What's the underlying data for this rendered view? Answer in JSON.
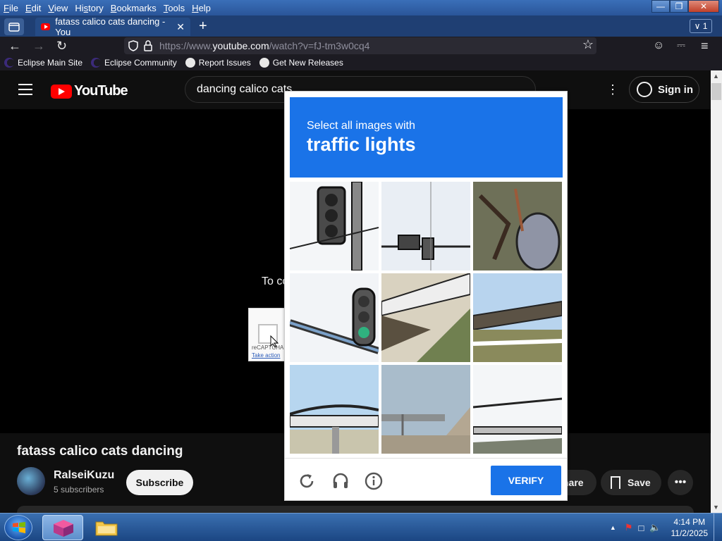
{
  "menubar": {
    "items": [
      "File",
      "Edit",
      "View",
      "History",
      "Bookmarks",
      "Tools",
      "Help"
    ],
    "underlines": [
      "F",
      "E",
      "V",
      "s",
      "B",
      "T",
      "H"
    ]
  },
  "tabs": {
    "active_title": "fatass calico cats dancing - You",
    "tab_count": "1"
  },
  "navbar": {
    "url_prefix": "https://www.",
    "url_host": "youtube.com",
    "url_path": "/watch?v=fJ-tm3w0cq4"
  },
  "bookmarks": [
    {
      "label": "Eclipse Main Site",
      "icon": "eclipse-icon"
    },
    {
      "label": "Eclipse Community",
      "icon": "eclipse-icon"
    },
    {
      "label": "Report Issues",
      "icon": "github-icon"
    },
    {
      "label": "Get New Releases",
      "icon": "github-icon"
    }
  ],
  "youtube": {
    "logo_text": "YouTube",
    "search_value": "dancing calico cats",
    "signin_label": "Sign in",
    "player_message": "To co",
    "recaptcha_text": "reCAPTCHA",
    "recaptcha_action": "Take action",
    "video_title": "fatass calico cats dancing",
    "channel_name": "RalseiKuzu",
    "channel_subs": "5 subscribers",
    "subscribe_label": "Subscribe",
    "share_label": "hare",
    "save_label": "Save"
  },
  "captcha": {
    "instruction": "Select all images with",
    "target": "traffic lights",
    "verify_label": "VERIFY",
    "header_color": "#1a73e8",
    "tiles": [
      {
        "scene": "traffic-light-closeup"
      },
      {
        "scene": "traffic-light-sky"
      },
      {
        "scene": "trash-tree-bark"
      },
      {
        "scene": "traffic-light-green"
      },
      {
        "scene": "overpass-shadow"
      },
      {
        "scene": "overpass-grass"
      },
      {
        "scene": "bridge-sky"
      },
      {
        "scene": "bridge-road"
      },
      {
        "scene": "bridge-trees"
      }
    ]
  },
  "taskbar": {
    "time": "4:14 PM",
    "date": "11/2/2025"
  }
}
